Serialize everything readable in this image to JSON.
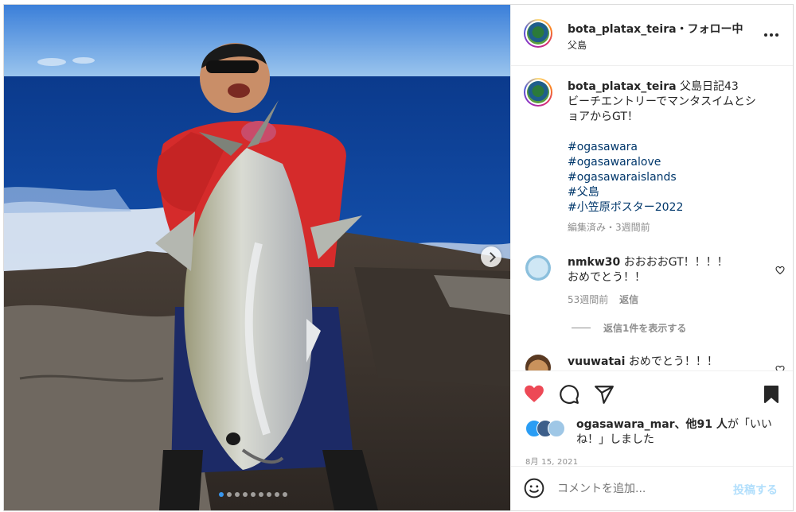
{
  "post": {
    "username": "bota_platax_teira",
    "follow_text": "・フォロー中",
    "location": "父島",
    "more_icon": "more-horizontal-icon"
  },
  "caption": {
    "username": "bota_platax_teira",
    "title": "父島日記43",
    "line1": "ビーチエントリーでマンタスイムとシ",
    "line2": "ョアからGT！",
    "hashtags": [
      "#ogasawara",
      "#ogasawaralove",
      "#ogasawaraislands",
      "#父島",
      "#小笠原ポスター2022"
    ],
    "meta": "編集済み・3週間前"
  },
  "comments": [
    {
      "username": "nmkw30",
      "text_line1": "おおおおGT！！！！",
      "text_line2": "おめでとう！！",
      "time": "53週間前",
      "reply_label": "返信",
      "view_replies": "返信1件を表示する"
    },
    {
      "username": "vuuwatai",
      "text_line1": "おめでとう！！！"
    }
  ],
  "likes": {
    "liker": "ogasawara_mar",
    "others": "、他91 人",
    "suffix_line1": "が「いい",
    "suffix_line2": "ね！」しました"
  },
  "date": "8月 15, 2021",
  "comment_box": {
    "placeholder": "コメントを追加...",
    "post_label": "投稿する"
  },
  "carousel": {
    "total_slides": 9,
    "current_slide": 1
  },
  "colors": {
    "like_red": "#ed4956",
    "link_blue": "#0095f6",
    "hashtag": "#00376b"
  }
}
